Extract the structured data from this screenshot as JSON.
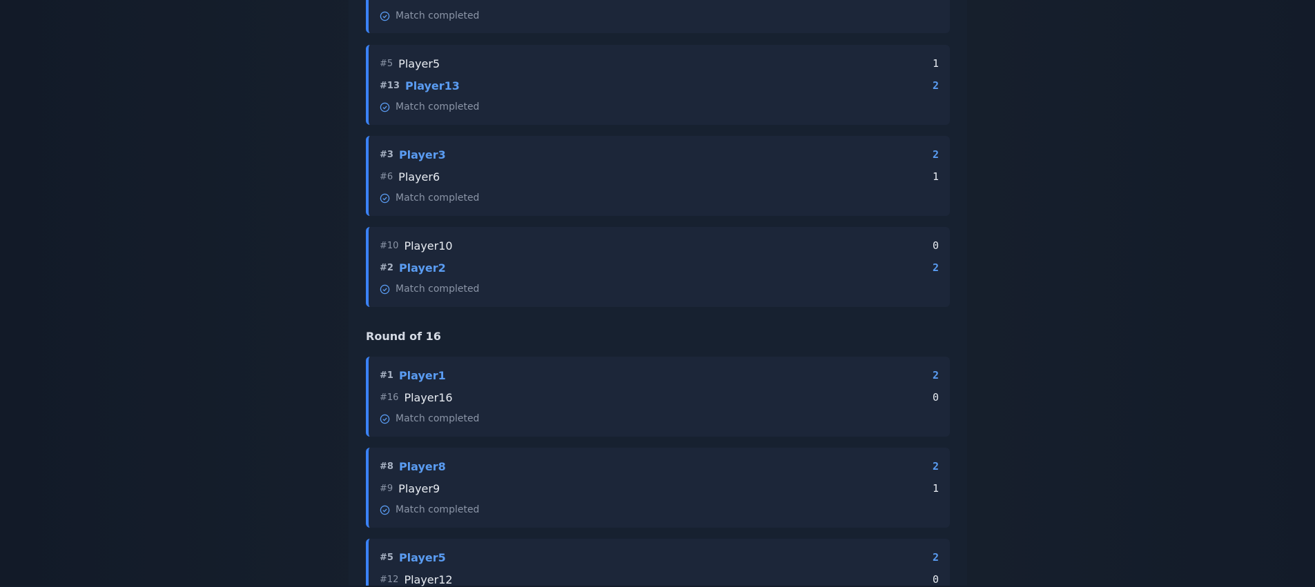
{
  "status_text": "Match completed",
  "round_title": "Round of 16",
  "matches": [
    {
      "status": "Match completed"
    },
    {
      "p1": {
        "seed": "#5",
        "name": "Player5",
        "score": "1"
      },
      "p2": {
        "seed": "#13",
        "name": "Player13",
        "score": "2"
      },
      "status": "Match completed"
    },
    {
      "p1": {
        "seed": "#3",
        "name": "Player3",
        "score": "2"
      },
      "p2": {
        "seed": "#6",
        "name": "Player6",
        "score": "1"
      },
      "status": "Match completed"
    },
    {
      "p1": {
        "seed": "#10",
        "name": "Player10",
        "score": "0"
      },
      "p2": {
        "seed": "#2",
        "name": "Player2",
        "score": "2"
      },
      "status": "Match completed"
    },
    {
      "p1": {
        "seed": "#1",
        "name": "Player1",
        "score": "2"
      },
      "p2": {
        "seed": "#16",
        "name": "Player16",
        "score": "0"
      },
      "status": "Match completed"
    },
    {
      "p1": {
        "seed": "#8",
        "name": "Player8",
        "score": "2"
      },
      "p2": {
        "seed": "#9",
        "name": "Player9",
        "score": "1"
      },
      "status": "Match completed"
    },
    {
      "p1": {
        "seed": "#5",
        "name": "Player5",
        "score": "2"
      },
      "p2": {
        "seed": "#12",
        "name": "Player12",
        "score": "0"
      }
    }
  ],
  "colors": {
    "accent": "#3b82f6",
    "winner_text": "#5a9cf2",
    "background": "#131c2b",
    "card": "#1c2639"
  },
  "icons": {
    "status": "check-circle-icon"
  }
}
